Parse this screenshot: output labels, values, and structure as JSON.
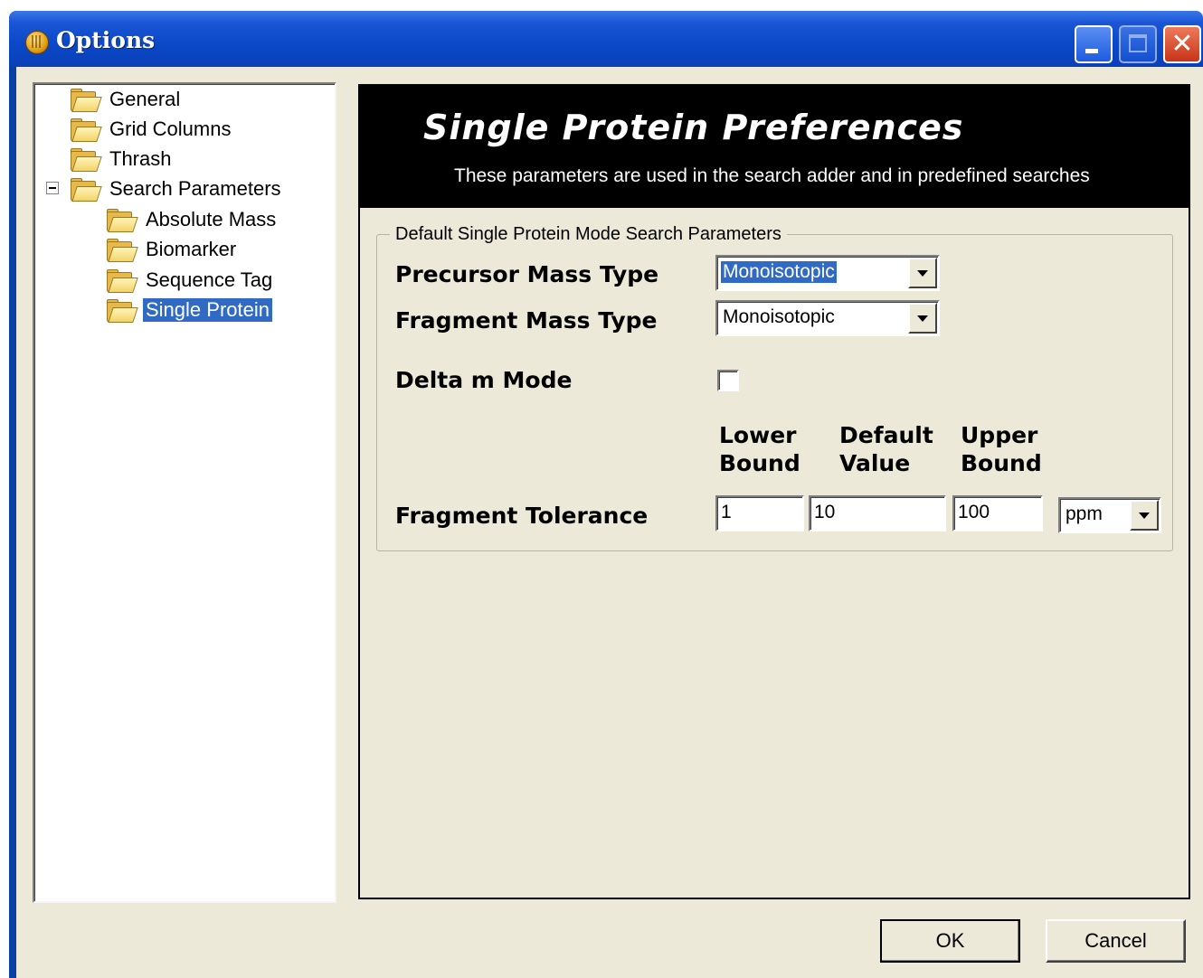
{
  "window": {
    "title": "Options",
    "controls": {
      "minimize_icon": "minimize-icon",
      "maximize_icon": "maximize-icon",
      "close_icon": "close-icon"
    }
  },
  "tree": {
    "items": [
      {
        "label": "General",
        "level": 0
      },
      {
        "label": "Grid Columns",
        "level": 0
      },
      {
        "label": "Thrash",
        "level": 0
      },
      {
        "label": "Search Parameters",
        "level": 0,
        "expanded": true
      },
      {
        "label": "Absolute Mass",
        "level": 1
      },
      {
        "label": "Biomarker",
        "level": 1
      },
      {
        "label": "Sequence Tag",
        "level": 1
      },
      {
        "label": "Single Protein",
        "level": 1,
        "selected": true
      }
    ],
    "expander_icon": "collapse-minus-icon",
    "item_icon": "folder-open-icon"
  },
  "panel": {
    "title": "Single Protein Preferences",
    "subtitle": "These parameters are used in the search adder and in predefined searches",
    "group": {
      "legend": "Default Single Protein Mode Search Parameters",
      "precursor_label": "Precursor Mass Type",
      "precursor_value": "Monoisotopic",
      "fragment_label": "Fragment Mass Type",
      "fragment_value": "Monoisotopic",
      "delta_label": "Delta m Mode",
      "delta_checked": false,
      "col_lower_1": "Lower",
      "col_lower_2": "Bound",
      "col_default_1": "Default",
      "col_default_2": "Value",
      "col_upper_1": "Upper",
      "col_upper_2": "Bound",
      "tolerance_label": "Fragment Tolerance",
      "tolerance_lower": "1",
      "tolerance_default": "10",
      "tolerance_upper": "100",
      "tolerance_unit": "ppm"
    }
  },
  "buttons": {
    "ok": "OK",
    "cancel": "Cancel"
  },
  "colors": {
    "title_bar": "#0a48c8",
    "selection": "#316ac5",
    "dialog_bg": "#ece9d8",
    "banner_bg": "#000000"
  }
}
